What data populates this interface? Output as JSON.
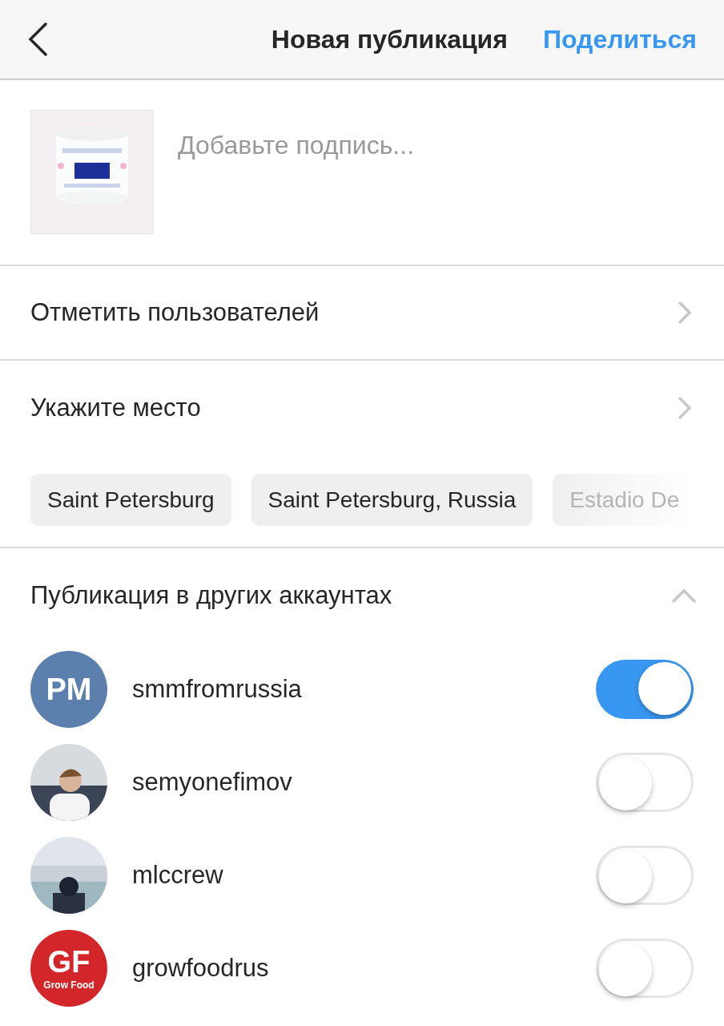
{
  "header": {
    "title": "Новая публикация",
    "action": "Поделиться"
  },
  "caption": {
    "placeholder": "Добавьте подпись..."
  },
  "menu_rows": [
    {
      "label": "Отметить пользователей"
    },
    {
      "label": "Укажите место"
    }
  ],
  "location_suggestions": [
    {
      "label": "Saint Petersburg",
      "faded": false
    },
    {
      "label": "Saint Petersburg, Russia",
      "faded": false
    },
    {
      "label": "Estadio De",
      "faded": true
    }
  ],
  "other_accounts": {
    "title": "Публикация в других аккаунтах",
    "expanded": true,
    "accounts": [
      {
        "username": "smmfromrussia",
        "on": true,
        "avatar": {
          "kind": "initials",
          "text": "PM",
          "color": "#5b80ad"
        }
      },
      {
        "username": "semyonefimov",
        "on": false
      },
      {
        "username": "mlccrew",
        "on": false
      },
      {
        "username": "growfoodrus",
        "on": false,
        "avatar": {
          "kind": "initials",
          "text": "GF",
          "caption": "Grow Food",
          "color": "#d3262a"
        }
      }
    ]
  }
}
